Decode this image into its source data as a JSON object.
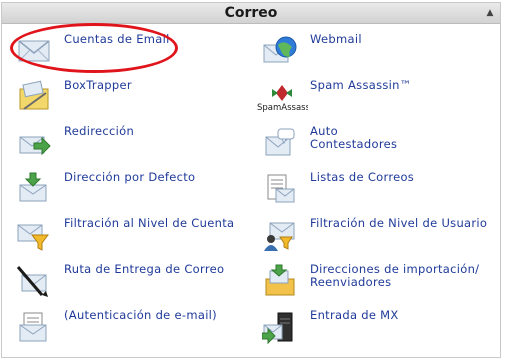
{
  "panel": {
    "title": "Correo"
  },
  "items": [
    {
      "key": "cuentas",
      "label": "Cuentas de Email",
      "icon": "email-envelope-icon"
    },
    {
      "key": "webmail",
      "label": "Webmail",
      "icon": "webmail-globe-icon"
    },
    {
      "key": "boxtrapper",
      "label": "BoxTrapper",
      "icon": "boxtrapper-icon"
    },
    {
      "key": "spam",
      "label": "Spam Assassin™",
      "icon": "spam-assassin-logo-icon",
      "logo_text": "SpamAssassin"
    },
    {
      "key": "redireccion",
      "label": "Redirección",
      "icon": "forwarding-arrow-icon"
    },
    {
      "key": "auto",
      "label_line1": "Auto",
      "label_line2": "Contestadores",
      "icon": "auto-responder-icon"
    },
    {
      "key": "defecto",
      "label": "Dirección por Defecto",
      "icon": "default-address-icon"
    },
    {
      "key": "listas",
      "label": "Listas de Correos",
      "icon": "mailing-lists-icon"
    },
    {
      "key": "filtro_cuenta",
      "label": "Filtración al Nivel de Cuenta",
      "icon": "account-filter-funnel-icon"
    },
    {
      "key": "filtro_usuario",
      "label": "Filtración de Nivel de Usuario",
      "icon": "user-filter-icon"
    },
    {
      "key": "ruta",
      "label": "Ruta de Entrega de Correo",
      "icon": "delivery-route-icon"
    },
    {
      "key": "importacion",
      "label_line1": "Direcciones de importación/",
      "label_line2": "Reenviadores",
      "icon": "import-addresses-icon"
    },
    {
      "key": "autenticacion",
      "label": "(Autenticación de e-mail)",
      "icon": "email-authentication-icon"
    },
    {
      "key": "mx",
      "label": "Entrada de MX",
      "icon": "mx-entry-server-icon"
    }
  ],
  "colors": {
    "link": "#1f3a99",
    "highlight": "#e0141b",
    "header_bg": "#dcdcdc"
  }
}
